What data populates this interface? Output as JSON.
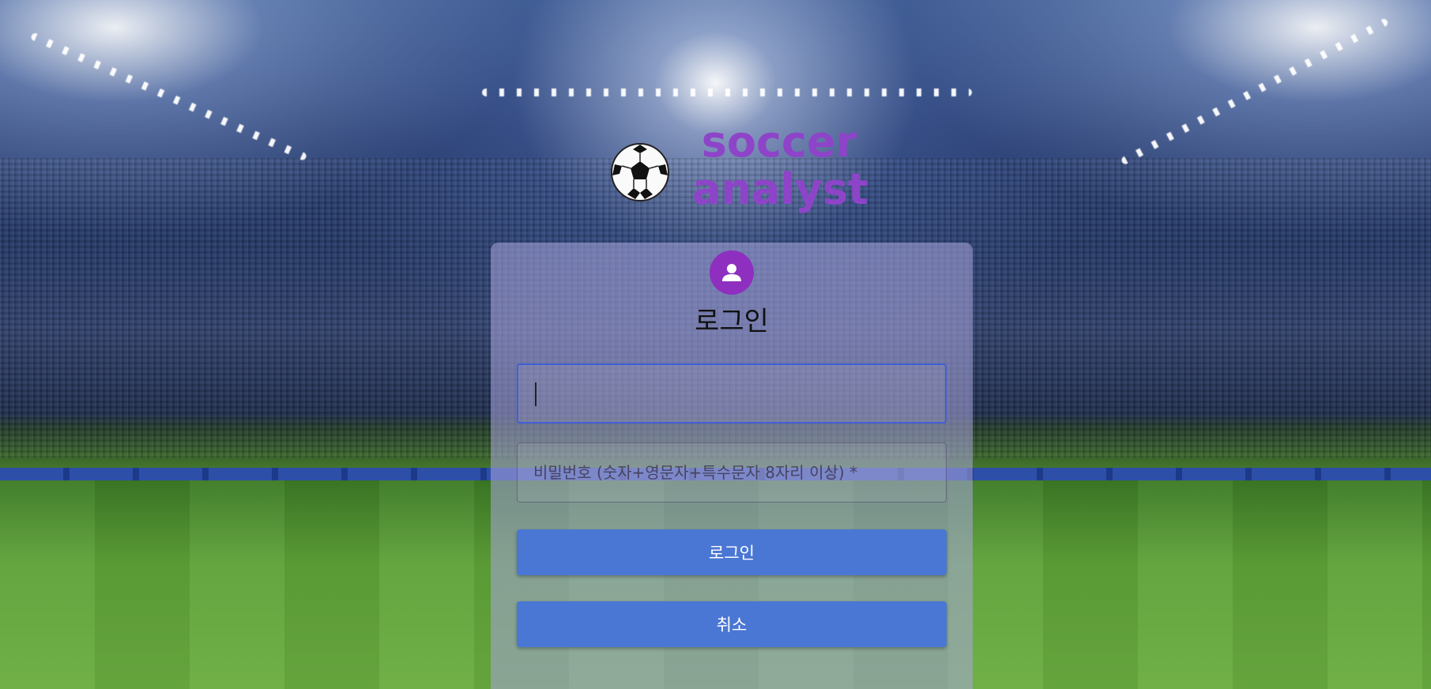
{
  "brand": {
    "title_line1": "soccer",
    "title_line2": "analyst",
    "icon": "soccer-ball-icon",
    "color": "#8e44c8"
  },
  "login_card": {
    "avatar_icon": "user-icon",
    "title": "로그인",
    "id_field": {
      "value": "",
      "placeholder": ""
    },
    "password_field": {
      "value": "",
      "placeholder": "비밀번호 (숫자+영문자+특수문자 8자리 이상) *"
    },
    "login_button": "로그인",
    "cancel_button": "취소"
  },
  "colors": {
    "accent": "#4a77d4",
    "avatar": "#8e2fbf",
    "focus_border": "#3f5fd6"
  }
}
